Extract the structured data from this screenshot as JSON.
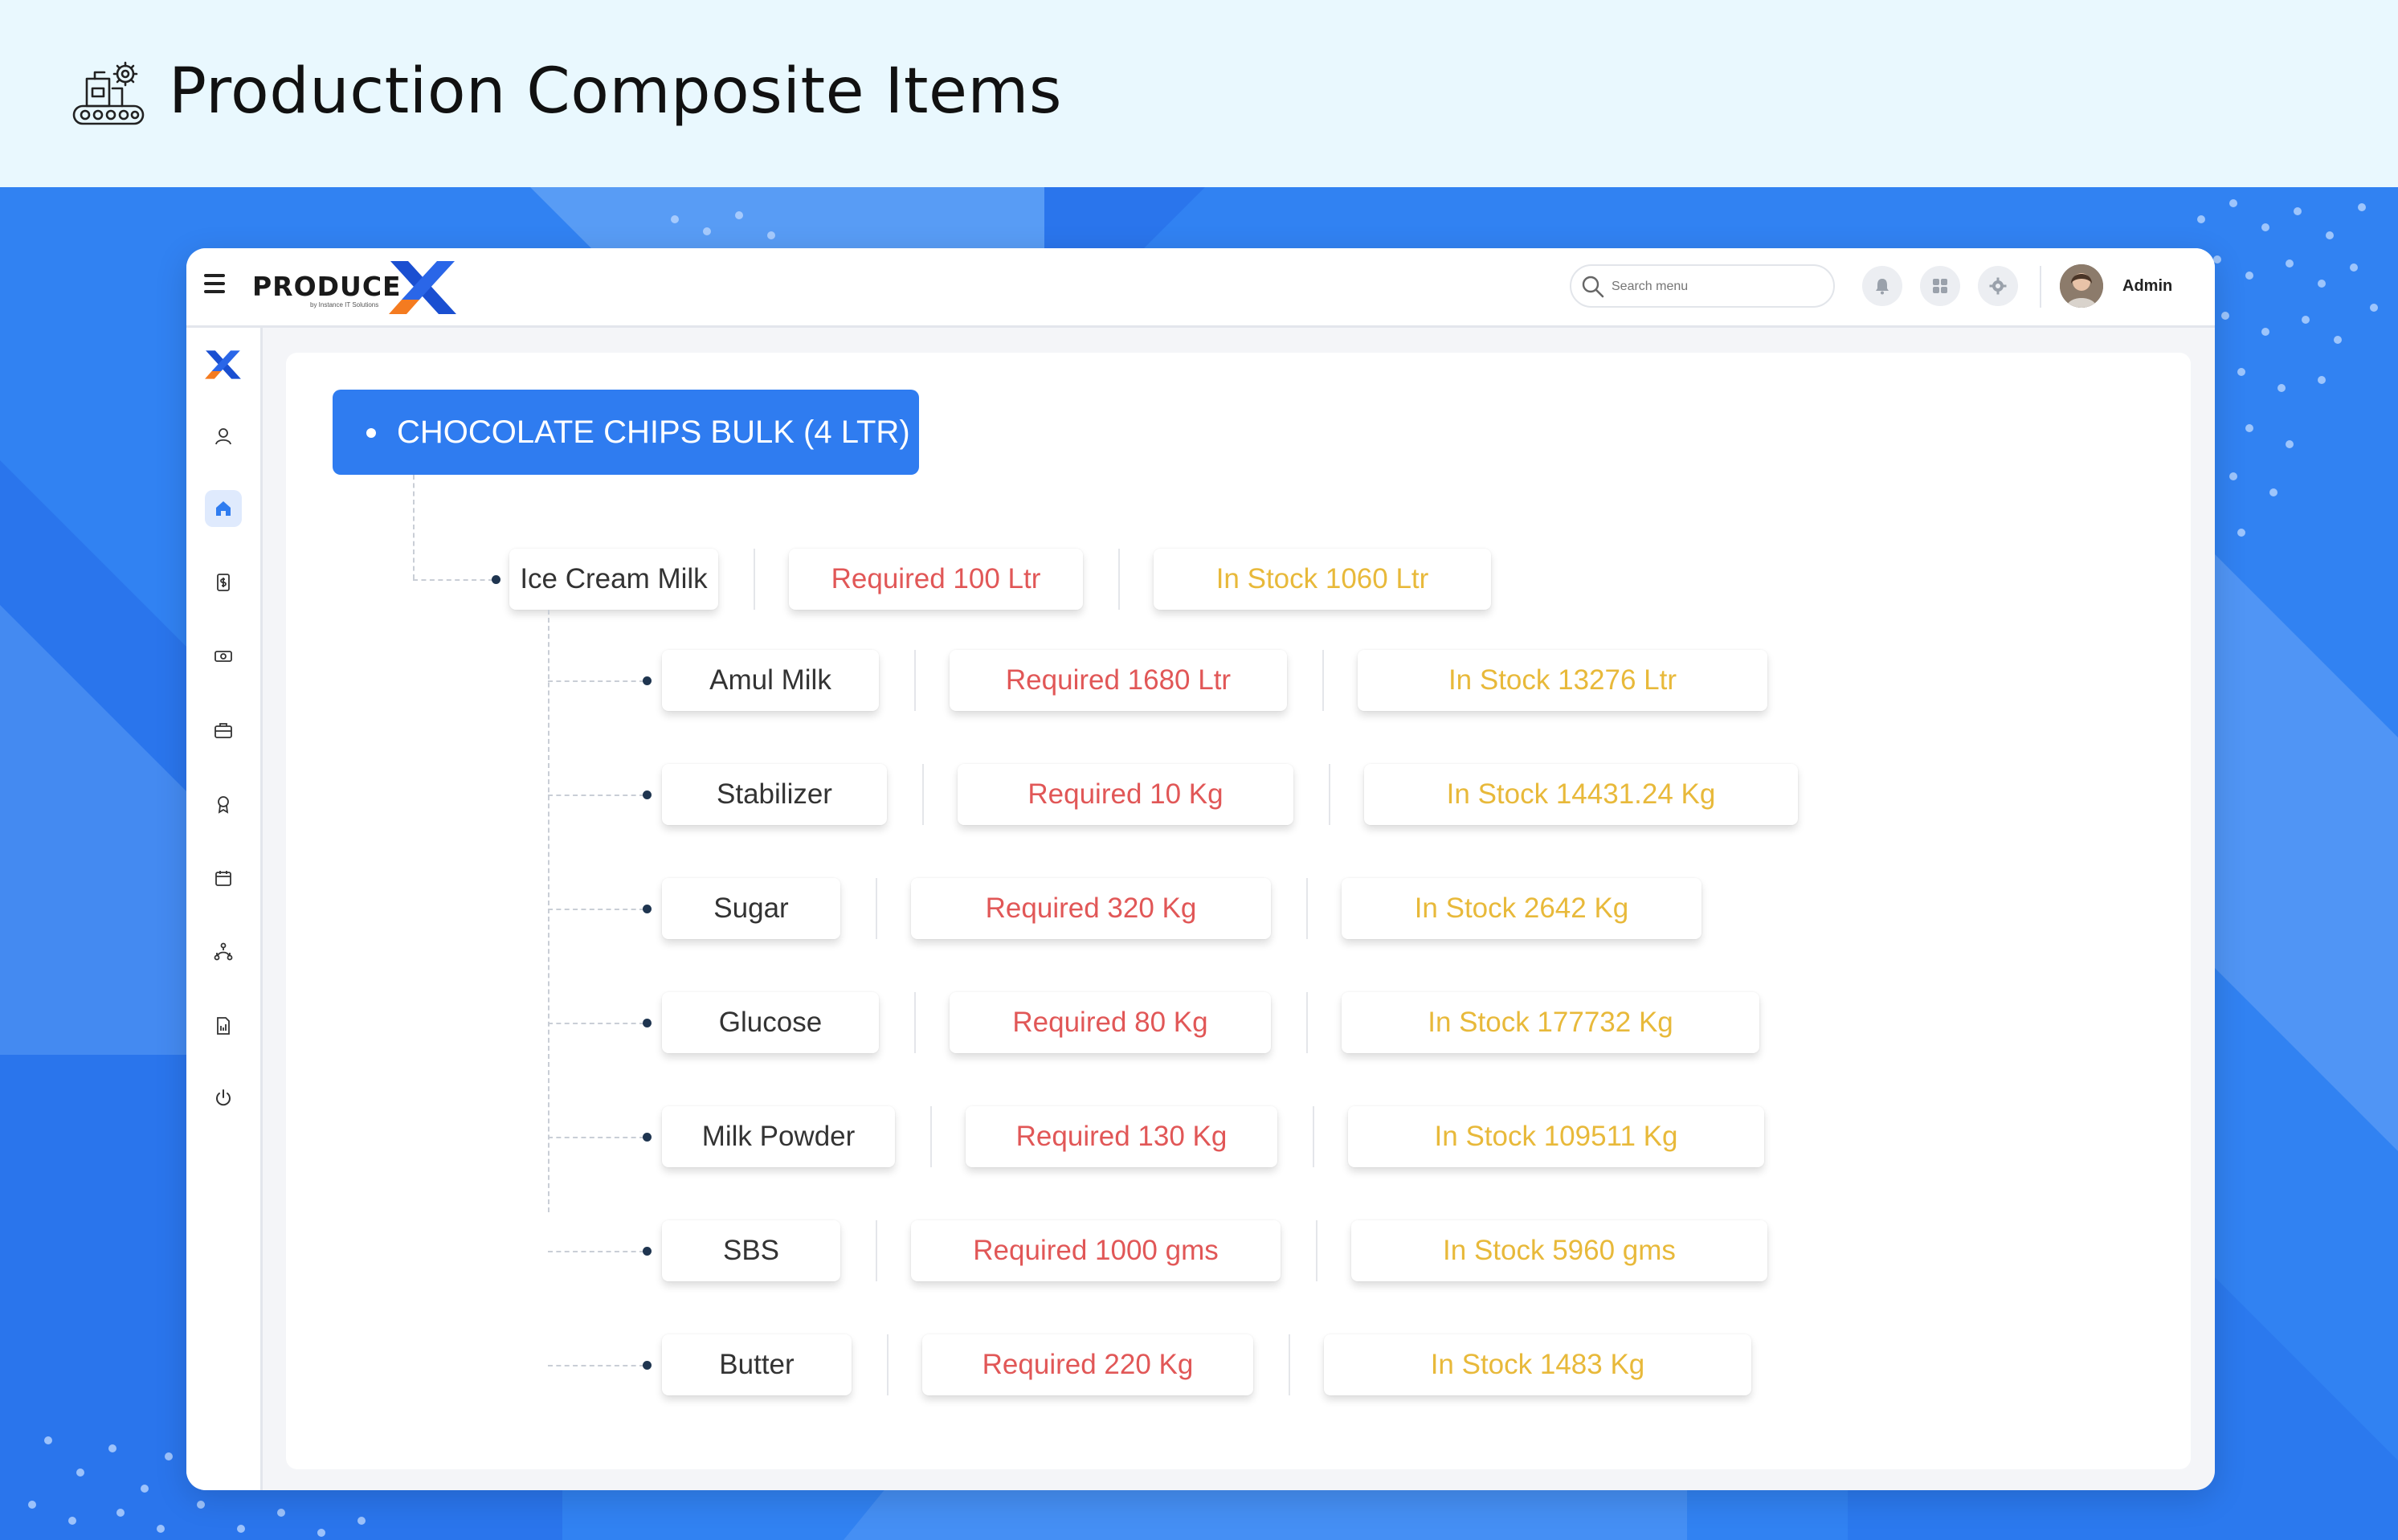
{
  "banner": {
    "title": "Production Composite Items",
    "icon": "production-line-icon"
  },
  "app": {
    "logo_text": "PRODUCE",
    "logo_sub": "by Instance IT Solutions",
    "search_placeholder": "Search menu",
    "user_name": "Admin",
    "topbar_icons": [
      "bell-icon",
      "apps-grid-icon",
      "gear-icon"
    ],
    "sidebar_icons": [
      "user-icon",
      "home-icon",
      "money-doc-icon",
      "cash-icon",
      "briefcase-icon",
      "badge-icon",
      "calendar-icon",
      "flow-icon",
      "report-icon",
      "power-icon"
    ],
    "colors": {
      "primary": "#2f7cf0",
      "required": "#e15757",
      "stock": "#e8b93a"
    }
  },
  "tree": {
    "root": "CHOCOLATE CHIPS BULK (4 LTR)",
    "level1": {
      "name": "Ice Cream Milk",
      "required": "Required 100 Ltr",
      "stock": "In Stock 1060 Ltr"
    },
    "children": [
      {
        "name": "Amul Milk",
        "required": "Required 1680 Ltr",
        "stock": "In Stock 13276 Ltr"
      },
      {
        "name": "Stabilizer",
        "required": "Required 10 Kg",
        "stock": "In Stock 14431.24 Kg"
      },
      {
        "name": "Sugar",
        "required": "Required 320 Kg",
        "stock": "In Stock 2642 Kg"
      },
      {
        "name": "Glucose",
        "required": "Required 80 Kg",
        "stock": "In Stock 177732 Kg"
      },
      {
        "name": "Milk Powder",
        "required": "Required 130 Kg",
        "stock": "In Stock 109511 Kg"
      },
      {
        "name": "SBS",
        "required": "Required 1000 gms",
        "stock": "In Stock 5960 gms"
      },
      {
        "name": "Butter",
        "required": "Required 220 Kg",
        "stock": "In Stock 1483 Kg"
      }
    ]
  }
}
